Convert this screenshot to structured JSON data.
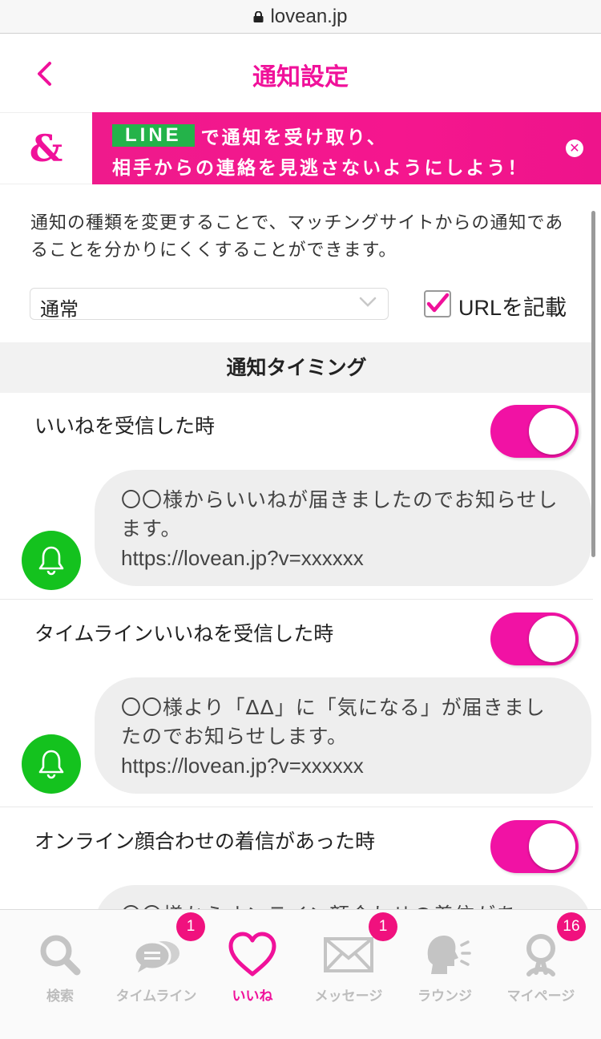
{
  "browser": {
    "url": "lovean.jp"
  },
  "header": {
    "title": "通知設定"
  },
  "banner": {
    "logo": "&",
    "line_badge": "LINE",
    "text_line1": "で通知を受け取り、",
    "text_line2": "相手からの連絡を見逃さないようにしよう！",
    "close_glyph": "✕"
  },
  "settings": {
    "description": "通知の種類を変更することで、マッチングサイトからの通知であることを分かりにくくすることができます。",
    "notification_type": "通常",
    "include_url_label": "URLを記載",
    "include_url_checked": true
  },
  "timing": {
    "heading": "通知タイミング",
    "items": [
      {
        "label": "いいねを受信した時",
        "enabled": true,
        "message": "〇〇様からいいねが届きましたのでお知らせします。",
        "url": "https://lovean.jp?v=xxxxxx"
      },
      {
        "label": "タイムラインいいねを受信した時",
        "enabled": true,
        "message": "〇〇様より「ΔΔ」に「気になる」が届きましたのでお知らせします。",
        "url": "https://lovean.jp?v=xxxxxx"
      },
      {
        "label": "オンライン顔合わせの着信があった時",
        "enabled": true,
        "message": "〇〇様からオンライン顔合わせの着信があ",
        "url": ""
      }
    ]
  },
  "tabbar": {
    "tabs": [
      {
        "label": "検索",
        "icon": "search-icon",
        "badge": ""
      },
      {
        "label": "タイムライン",
        "icon": "chat-bubbles-icon",
        "badge": "1"
      },
      {
        "label": "いいね",
        "icon": "heart-icon",
        "badge": ""
      },
      {
        "label": "メッセージ",
        "icon": "envelope-icon",
        "badge": "1"
      },
      {
        "label": "ラウンジ",
        "icon": "speaking-head-icon",
        "badge": ""
      },
      {
        "label": "マイページ",
        "icon": "person-icon",
        "badge": "16"
      }
    ]
  },
  "colors": {
    "accent": "#f0119a",
    "line_green": "#24b34a",
    "bell_green": "#14c21e",
    "badge": "#f0117e"
  }
}
